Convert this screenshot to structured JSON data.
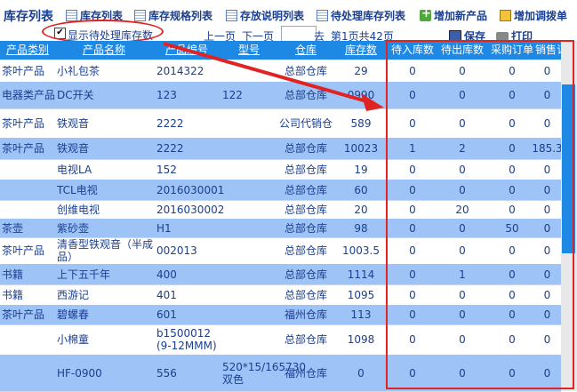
{
  "title": "库存列表",
  "nav": [
    {
      "label": "库存列表",
      "icon": "list-icon"
    },
    {
      "label": "库存规格列表",
      "icon": "list-icon"
    },
    {
      "label": "存放说明列表",
      "icon": "list-icon"
    },
    {
      "label": "待处理库存列表",
      "icon": "list-icon"
    },
    {
      "label": "增加新产品",
      "icon": "add-icon"
    },
    {
      "label": "增加调拨单",
      "icon": "adjust-icon"
    }
  ],
  "toolbar": {
    "show_pending_label": "显示待处理库存数",
    "show_pending_checked": "✔",
    "prev": "上一页",
    "next": "下一页",
    "go": "去",
    "page_info": "第1页共42页",
    "save": "保存",
    "print": "打印"
  },
  "columns": [
    "产品类别",
    "产品名称",
    "产品编号",
    "型号",
    "仓库",
    "库存数",
    "待入库数",
    "待出库数",
    "采购订单",
    "销售订单"
  ],
  "rows": [
    [
      "茶叶产品",
      "小礼包茶",
      "2014322",
      "",
      "总部仓库",
      "29",
      "0",
      "0",
      "0",
      "0"
    ],
    [
      "电器类产品",
      "DC开关",
      "123",
      "122",
      "总部仓库",
      "0990",
      "0",
      "0",
      "0",
      "0"
    ],
    [
      "茶叶产品",
      "铁观音",
      "2222",
      "",
      "公司代销仓",
      "589",
      "0",
      "0",
      "0",
      "0"
    ],
    [
      "茶叶产品",
      "铁观音",
      "2222",
      "",
      "总部仓库",
      "10023",
      "1",
      "2",
      "0",
      "185.3"
    ],
    [
      "",
      "电视LA",
      "152",
      "",
      "总部仓库",
      "19",
      "0",
      "0",
      "0",
      "0"
    ],
    [
      "",
      "TCL电视",
      "2016030001",
      "",
      "总部仓库",
      "60",
      "0",
      "0",
      "0",
      "0"
    ],
    [
      "",
      "创维电视",
      "2016030002",
      "",
      "总部仓库",
      "20",
      "0",
      "20",
      "0",
      "0"
    ],
    [
      "茶壶",
      "紫砂壶",
      "H1",
      "",
      "总部仓库",
      "98",
      "0",
      "0",
      "50",
      "0"
    ],
    [
      "茶叶产品",
      "清香型铁观音（半成品）",
      "002013",
      "",
      "总部仓库",
      "1003.5",
      "0",
      "0",
      "0",
      "0"
    ],
    [
      "书籍",
      "上下五千年",
      "400",
      "",
      "总部仓库",
      "1114",
      "0",
      "1",
      "0",
      "0"
    ],
    [
      "书籍",
      "西游记",
      "401",
      "",
      "总部仓库",
      "1095",
      "0",
      "0",
      "0",
      "0"
    ],
    [
      "茶叶产品",
      "碧螺春",
      "601",
      "",
      "福州仓库",
      "113",
      "0",
      "0",
      "0",
      "0"
    ],
    [
      "",
      "小棉童",
      "b1500012 (9-12MMM)",
      "",
      "总部仓库",
      "1098",
      "0",
      "0",
      "0",
      "0"
    ],
    [
      "",
      "HF-0900",
      "556",
      "520*15/165730双色",
      "福州仓库",
      "0",
      "0",
      "0",
      "0",
      "0"
    ]
  ],
  "colors": {
    "header": "#1e88e5",
    "alt_row": "#9dc3f7",
    "text": "#1b3f8f",
    "annotation": "#e02424"
  }
}
